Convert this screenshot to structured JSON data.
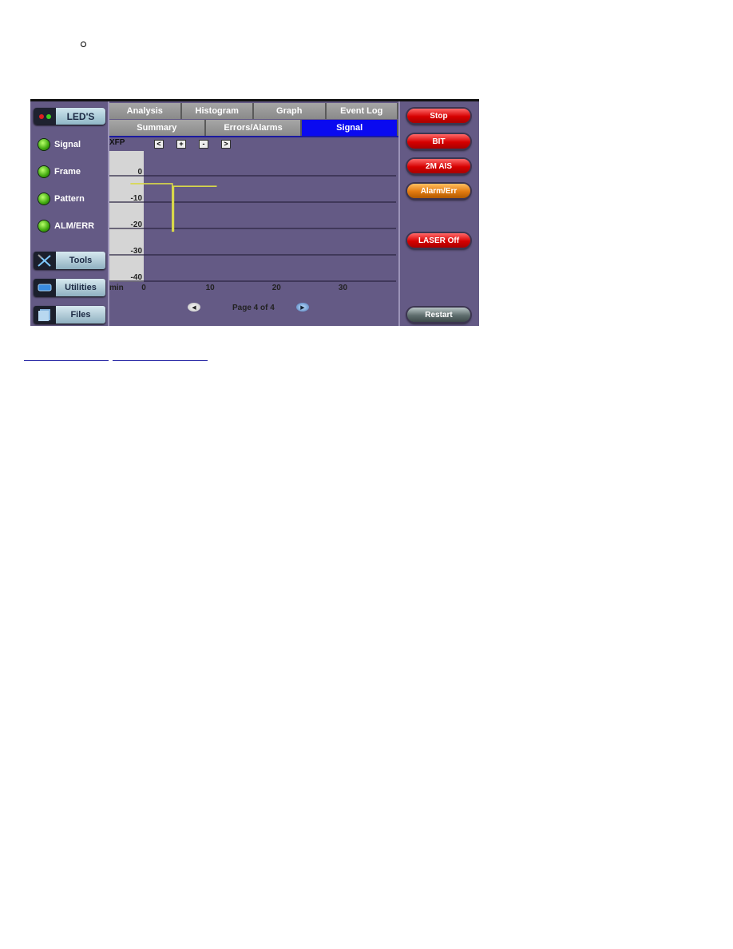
{
  "bullet_icon": "hollow-circle-bullet",
  "left_panel": {
    "leds_button": {
      "label": "LED'S",
      "icon": "red-green-dots-icon"
    },
    "led_indicators": [
      {
        "label": "Signal",
        "status_color": "#4fc014"
      },
      {
        "label": "Frame",
        "status_color": "#4fc014"
      },
      {
        "label": "Pattern",
        "status_color": "#4fc014"
      },
      {
        "label": "ALM/ERR",
        "status_color": "#4fc014"
      }
    ],
    "menu_buttons": [
      {
        "label": "Tools",
        "icon": "tools-icon"
      },
      {
        "label": "Utilities",
        "icon": "utilities-icon"
      },
      {
        "label": "Files",
        "icon": "files-icon"
      }
    ]
  },
  "tabs": {
    "primary": [
      "Analysis",
      "Histogram",
      "Graph",
      "Event Log"
    ],
    "secondary": [
      "Summary",
      "Errors/Alarms",
      "Signal"
    ],
    "active_secondary": "Signal",
    "active_color": "#0a0af0"
  },
  "graph_controls": {
    "label": "XFP",
    "buttons": [
      "<",
      "+",
      "-",
      ">"
    ]
  },
  "chart_data": {
    "type": "line",
    "title": "",
    "xlabel": "min",
    "ylabel": "",
    "xlim": [
      0,
      38
    ],
    "ylim": [
      -40,
      0
    ],
    "x_ticks": [
      0,
      10,
      20,
      30
    ],
    "y_ticks": [
      0,
      -10,
      -20,
      -30,
      -40
    ],
    "grid": true,
    "series": [
      {
        "name": "XFP signal level",
        "color": "#d8d84a",
        "points": [
          [
            -2,
            -3
          ],
          [
            4.3,
            -3
          ],
          [
            4.3,
            -21
          ],
          [
            4.5,
            -21
          ],
          [
            4.5,
            -4
          ],
          [
            11,
            -4
          ]
        ]
      }
    ]
  },
  "pagination": {
    "text": "Page 4 of 4",
    "prev_icon": "left-arrow-icon",
    "next_icon": "right-arrow-icon"
  },
  "right_panel": {
    "buttons": [
      {
        "label": "Stop",
        "style": "red"
      },
      {
        "label": "BIT",
        "style": "red"
      },
      {
        "label": "2M AIS",
        "style": "red"
      },
      {
        "label": "Alarm/Err",
        "style": "orange"
      },
      {
        "label": "LASER Off",
        "style": "red"
      },
      {
        "label": "Restart",
        "style": "gray"
      }
    ]
  },
  "colors": {
    "panel_bg": "#645a85",
    "axis_bg": "#d5d5d5",
    "trace": "#d8d84a",
    "link_underline": "#1a1aa0"
  }
}
